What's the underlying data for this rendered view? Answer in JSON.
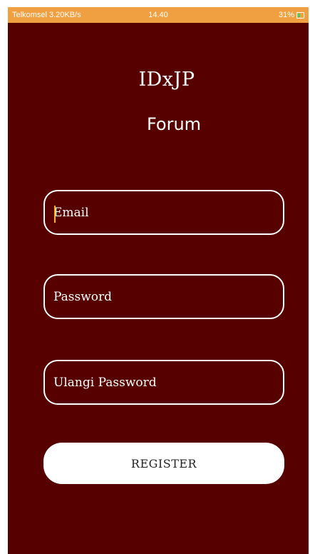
{
  "status_bar": {
    "left_text": "Telkomsel 3.20KB/s",
    "time": "14.40",
    "right_text": "31%",
    "battery_icon": "battery-icon"
  },
  "header": {
    "title": "IDxJP",
    "subtitle": "Forum"
  },
  "form": {
    "email_placeholder": "Email",
    "password_placeholder": "Password",
    "confirm_password_placeholder": "Ulangi Password",
    "register_label": "REGISTER"
  },
  "colors": {
    "background": "#560000",
    "status_bar": "#f0a040",
    "input_border": "#ffffff",
    "button_background": "#ffffff",
    "caret": "#ffb020"
  }
}
